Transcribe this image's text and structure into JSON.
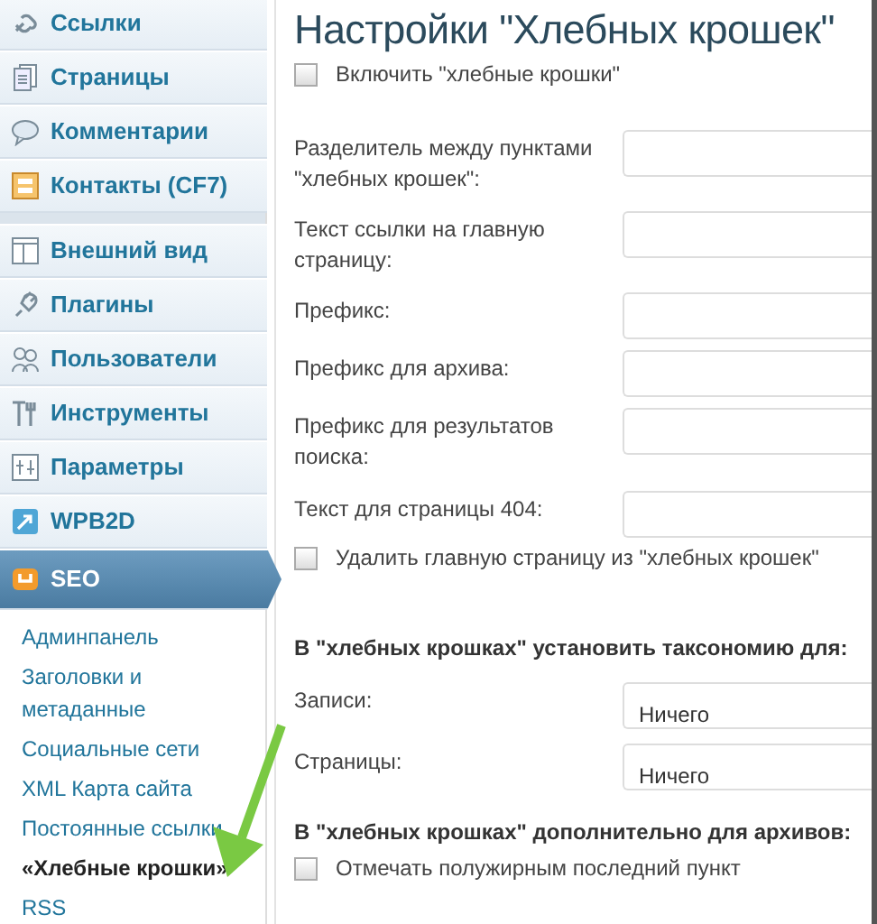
{
  "sidebar": {
    "groups": [
      {
        "items": [
          {
            "label": "Ссылки",
            "selected": false
          },
          {
            "label": "Страницы",
            "selected": false
          },
          {
            "label": "Комментарии",
            "selected": false
          },
          {
            "label": "Контакты (CF7)",
            "selected": false
          }
        ]
      },
      {
        "items": [
          {
            "label": "Внешний вид",
            "selected": false
          },
          {
            "label": "Плагины",
            "selected": false
          },
          {
            "label": "Пользователи",
            "selected": false
          },
          {
            "label": "Инструменты",
            "selected": false
          },
          {
            "label": "Параметры",
            "selected": false
          },
          {
            "label": "WPB2D",
            "selected": false
          },
          {
            "label": "SEO",
            "selected": true
          }
        ]
      }
    ],
    "submenu": [
      {
        "label": "Админпанель",
        "selected": false
      },
      {
        "label": "Заголовки и метаданные",
        "selected": false
      },
      {
        "label": "Социальные сети",
        "selected": false
      },
      {
        "label": "XML Карта сайта",
        "selected": false
      },
      {
        "label": "Постоянные ссылки",
        "selected": false
      },
      {
        "label": "«Хлебные крошки»",
        "selected": true
      },
      {
        "label": "RSS",
        "selected": false
      }
    ]
  },
  "main": {
    "title": "Настройки \"Хлебных крошек\"",
    "enable": {
      "label": "Включить \"хлебные крошки\"",
      "checked": false
    },
    "fields": [
      {
        "label": "Разделитель между пунктами \"хлебных крошек\":",
        "kind": "text"
      },
      {
        "label": "Текст ссылки на главную страницу:",
        "kind": "text"
      },
      {
        "label": "Префикс:",
        "kind": "text"
      },
      {
        "label": "Префикс для архива:",
        "kind": "text"
      },
      {
        "label": "Префикс для результатов поиска:",
        "kind": "text"
      },
      {
        "label": "Текст для страницы 404:",
        "kind": "text"
      }
    ],
    "remove_home": {
      "label": "Удалить главную страницу из \"хлебных крошек\"",
      "checked": false
    },
    "taxonomy_heading": "В \"хлебных крошках\" установить таксономию для:",
    "selects": [
      {
        "label": "Записи:",
        "value": "Ничего"
      },
      {
        "label": "Страницы:",
        "value": "Ничего"
      }
    ],
    "archives_heading": "В \"хлебных крошках\" дополнительно для архивов:",
    "bold_last": {
      "label": "Отмечать полужирным последний пункт",
      "checked": false
    }
  }
}
